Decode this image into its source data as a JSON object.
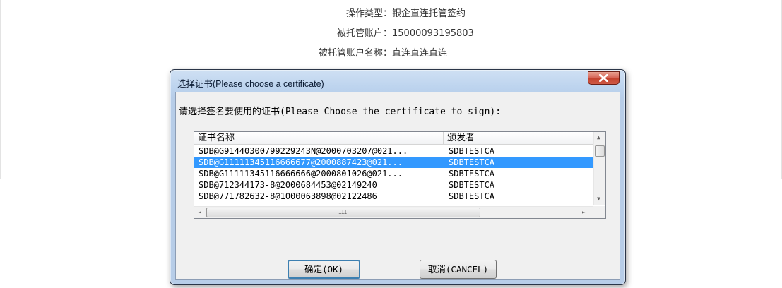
{
  "page": {
    "rows": [
      {
        "label": "操作类型：",
        "value": "银企直连托管签约"
      },
      {
        "label": "被托管账户：",
        "value": "15000093195803"
      },
      {
        "label": "被托管账户名称：",
        "value": "直连直连直连"
      }
    ]
  },
  "dialog": {
    "title": "选择证书(Please choose a certificate)",
    "close_icon": "close-icon",
    "prompt": "请选择签名要使用的证书(Please Choose  the certificate to sign):",
    "columns": [
      "证书名称",
      "颁发者"
    ],
    "rows": [
      {
        "name": "SDB@G91440300799229243N@2000703207@021...",
        "issuer": "SDBTESTCA"
      },
      {
        "name": "SDB@G11111345116666677@2000887423@021...",
        "issuer": "SDBTESTCA"
      },
      {
        "name": "SDB@G11111345116666666@2000801026@021...",
        "issuer": "SDBTESTCA"
      },
      {
        "name": "SDB@712344173-8@2000684453@02149240",
        "issuer": "SDBTESTCA"
      },
      {
        "name": "SDB@771782632-8@1000063898@02122486",
        "issuer": "SDBTESTCA"
      }
    ],
    "selected_row": 1,
    "scroll": {
      "up": "▲",
      "down": "▼",
      "left": "◄",
      "right": "►",
      "grip": "III"
    },
    "ok_label": "确定(OK)",
    "cancel_label": "取消(CANCEL)"
  }
}
